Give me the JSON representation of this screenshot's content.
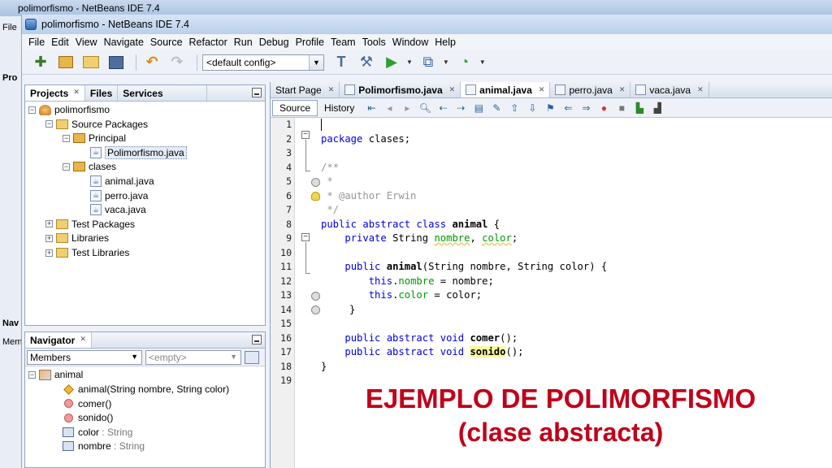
{
  "back_window": {
    "title": "polimorfismo - NetBeans IDE 7.4",
    "menu_stub": "File",
    "pro_stub": "Pro",
    "nav_stub": "Nav",
    "mem_stub": "Mem"
  },
  "window": {
    "title": "polimorfismo - NetBeans IDE 7.4"
  },
  "menu": [
    "File",
    "Edit",
    "View",
    "Navigate",
    "Source",
    "Refactor",
    "Run",
    "Debug",
    "Profile",
    "Team",
    "Tools",
    "Window",
    "Help"
  ],
  "toolbar": {
    "config": "<default config>"
  },
  "projects_panel": {
    "tabs": [
      "Projects",
      "Files",
      "Services"
    ],
    "tree": [
      {
        "label": "polimorfismo",
        "icon": "project-icon",
        "depth": 0,
        "expander": "-"
      },
      {
        "label": "Source Packages",
        "icon": "folder-icon",
        "depth": 1,
        "expander": "-"
      },
      {
        "label": "Principal",
        "icon": "package-icon",
        "depth": 2,
        "expander": "-"
      },
      {
        "label": "Polimorfismo.java",
        "icon": "java-file-icon",
        "depth": 3,
        "expander": "",
        "selected": true
      },
      {
        "label": "clases",
        "icon": "package-icon",
        "depth": 2,
        "expander": "-"
      },
      {
        "label": "animal.java",
        "icon": "java-file-icon",
        "depth": 3,
        "expander": ""
      },
      {
        "label": "perro.java",
        "icon": "java-file-icon",
        "depth": 3,
        "expander": ""
      },
      {
        "label": "vaca.java",
        "icon": "java-file-icon",
        "depth": 3,
        "expander": ""
      },
      {
        "label": "Test Packages",
        "icon": "folder-icon",
        "depth": 1,
        "expander": "+"
      },
      {
        "label": "Libraries",
        "icon": "folder-icon",
        "depth": 1,
        "expander": "+"
      },
      {
        "label": "Test Libraries",
        "icon": "folder-icon",
        "depth": 1,
        "expander": "+"
      }
    ]
  },
  "navigator_panel": {
    "tab": "Navigator",
    "filter": "Members",
    "scope": "<empty>",
    "root": "animal",
    "members": [
      {
        "name": "animal(",
        "sig": "String nombre, String color",
        "tail": ")",
        "icon": "constructor-icon"
      },
      {
        "name": "comer()",
        "sig": "",
        "tail": "",
        "icon": "method-icon"
      },
      {
        "name": "sonido()",
        "sig": "",
        "tail": "",
        "icon": "method-icon"
      },
      {
        "name": "color",
        "sig": " : String",
        "tail": "",
        "icon": "field-icon"
      },
      {
        "name": "nombre",
        "sig": " : String",
        "tail": "",
        "icon": "field-icon"
      }
    ]
  },
  "editor": {
    "tabs": [
      {
        "label": "Start Page",
        "active": false
      },
      {
        "label": "Polimorfismo.java",
        "active": false
      },
      {
        "label": "animal.java",
        "active": true
      },
      {
        "label": "perro.java",
        "active": false
      },
      {
        "label": "vaca.java",
        "active": false
      }
    ],
    "source_label": "Source",
    "history_label": "History",
    "line_numbers": [
      "1",
      "2",
      "3",
      "4",
      "5",
      "6",
      "7",
      "8",
      "9",
      "10",
      "11",
      "12",
      "13",
      "14",
      "15",
      "16",
      "17",
      "18",
      "19"
    ],
    "code": {
      "l2_kw": "package",
      "l2_rest": " clases;",
      "l4": "/**",
      "l5": " *",
      "l6": " * @author Erwin",
      "l7": " */",
      "l8_kw": "public abstract class",
      "l8_name": "animal",
      "l8_rest": " {",
      "l9_kw": "private",
      "l9_type": " String ",
      "l9_f1": "nombre",
      "l9_sep": ", ",
      "l9_f2": "color",
      "l9_end": ";",
      "l11_kw": "public",
      "l11_name": "animal",
      "l11_rest": "(String nombre, String color) {",
      "l12_kw": "this",
      "l12_dot": ".",
      "l12_f": "nombre",
      "l12_rest": " = nombre;",
      "l13_kw": "this",
      "l13_dot": ".",
      "l13_f": "color",
      "l13_rest": " = color;",
      "l14": "}",
      "l16_kw": "public abstract void",
      "l16_name": "comer",
      "l16_rest": "();",
      "l17_kw": "public abstract void",
      "l17_name": "sonido",
      "l17_rest": "();",
      "l18": "}"
    }
  },
  "caption": {
    "line1": "EJEMPLO DE POLIMORFISMO",
    "line2": "(clase abstracta)",
    "color": "#c0001a"
  }
}
